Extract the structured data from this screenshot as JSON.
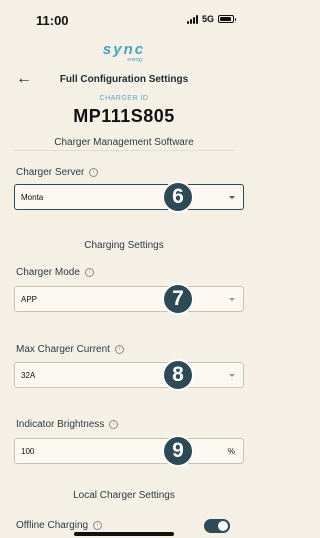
{
  "status_bar": {
    "time": "11:00",
    "network": "5G",
    "battery_level": 0.8
  },
  "logo": {
    "brand": "sync",
    "tagline": "energy"
  },
  "header": {
    "title": "Full Configuration Settings"
  },
  "charger": {
    "id_label": "CHARGER ID",
    "id": "MP111S805"
  },
  "sections": {
    "management": "Charger Management Software",
    "charging": "Charging Settings",
    "local": "Local Charger Settings"
  },
  "fields": {
    "charger_server": {
      "label": "Charger Server",
      "value": "Monta"
    },
    "charger_mode": {
      "label": "Charger Mode",
      "value": "APP"
    },
    "max_current": {
      "label": "Max Charger Current",
      "value": "32A"
    },
    "brightness": {
      "label": "Indicator Brightness",
      "value": "100",
      "unit": "%"
    },
    "offline_charging": {
      "label": "Offline Charging",
      "enabled": true
    }
  },
  "badges": {
    "b6": "6",
    "b7": "7",
    "b8": "8",
    "b9": "9"
  },
  "colors": {
    "accent": "#2d4a56",
    "brand": "#4aa4c4",
    "background": "#f5f0e6"
  }
}
